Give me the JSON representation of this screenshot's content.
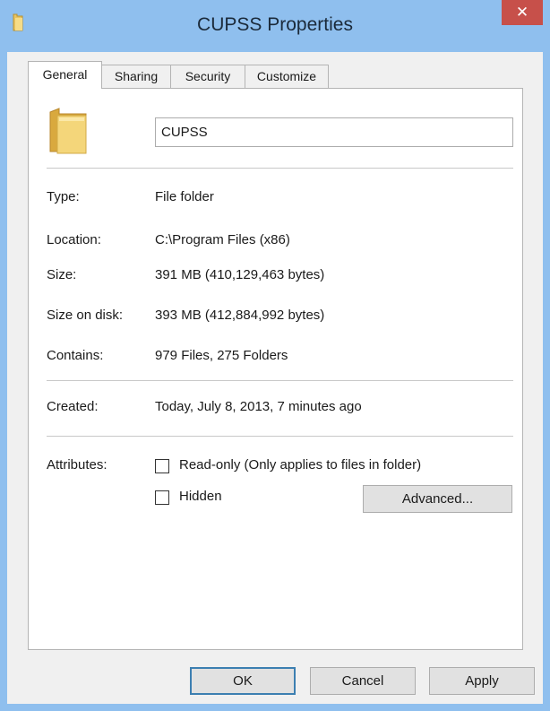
{
  "window": {
    "title": "CUPSS Properties",
    "close_glyph": "✕",
    "icon": "folder-icon"
  },
  "tabs": [
    {
      "label": "General",
      "active": true
    },
    {
      "label": "Sharing",
      "active": false
    },
    {
      "label": "Security",
      "active": false
    },
    {
      "label": "Customize",
      "active": false
    }
  ],
  "general": {
    "folder_name": "CUPSS",
    "type_label": "Type:",
    "type_value": "File folder",
    "location_label": "Location:",
    "location_value": "C:\\Program Files (x86)",
    "size_label": "Size:",
    "size_value": "391 MB (410,129,463 bytes)",
    "size_on_disk_label": "Size on disk:",
    "size_on_disk_value": "393 MB (412,884,992 bytes)",
    "contains_label": "Contains:",
    "contains_value": "979 Files, 275 Folders",
    "created_label": "Created:",
    "created_value": "Today, July 8, 2013, 7 minutes ago",
    "attributes_label": "Attributes:",
    "readonly_label": "Read-only (Only applies to files in folder)",
    "readonly_checked": false,
    "hidden_label": "Hidden",
    "hidden_checked": false,
    "advanced_label": "Advanced..."
  },
  "footer": {
    "ok_label": "OK",
    "cancel_label": "Cancel",
    "apply_label": "Apply"
  },
  "colors": {
    "frame": "#8fbfee",
    "close_button": "#c7504a",
    "dialog_background": "#f0f0f0",
    "folder_yellow": "#f4d67a"
  }
}
